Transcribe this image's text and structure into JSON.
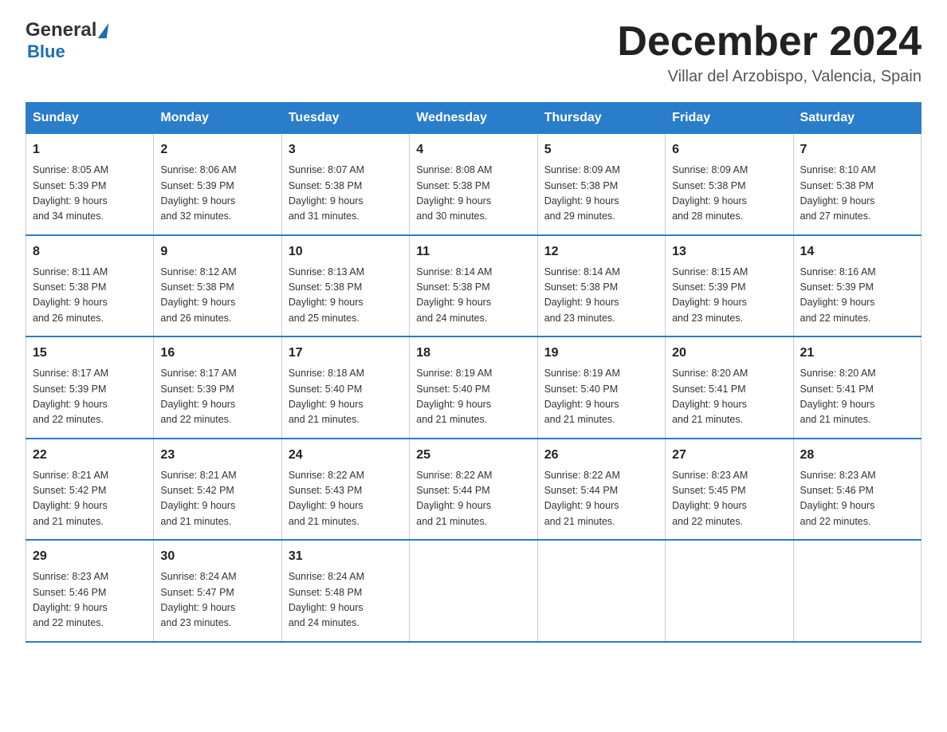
{
  "header": {
    "logo_general": "General",
    "logo_blue": "Blue",
    "title": "December 2024",
    "location": "Villar del Arzobispo, Valencia, Spain"
  },
  "days_of_week": [
    "Sunday",
    "Monday",
    "Tuesday",
    "Wednesday",
    "Thursday",
    "Friday",
    "Saturday"
  ],
  "weeks": [
    [
      {
        "day": "1",
        "sunrise": "8:05 AM",
        "sunset": "5:39 PM",
        "daylight": "9 hours and 34 minutes."
      },
      {
        "day": "2",
        "sunrise": "8:06 AM",
        "sunset": "5:39 PM",
        "daylight": "9 hours and 32 minutes."
      },
      {
        "day": "3",
        "sunrise": "8:07 AM",
        "sunset": "5:38 PM",
        "daylight": "9 hours and 31 minutes."
      },
      {
        "day": "4",
        "sunrise": "8:08 AM",
        "sunset": "5:38 PM",
        "daylight": "9 hours and 30 minutes."
      },
      {
        "day": "5",
        "sunrise": "8:09 AM",
        "sunset": "5:38 PM",
        "daylight": "9 hours and 29 minutes."
      },
      {
        "day": "6",
        "sunrise": "8:09 AM",
        "sunset": "5:38 PM",
        "daylight": "9 hours and 28 minutes."
      },
      {
        "day": "7",
        "sunrise": "8:10 AM",
        "sunset": "5:38 PM",
        "daylight": "9 hours and 27 minutes."
      }
    ],
    [
      {
        "day": "8",
        "sunrise": "8:11 AM",
        "sunset": "5:38 PM",
        "daylight": "9 hours and 26 minutes."
      },
      {
        "day": "9",
        "sunrise": "8:12 AM",
        "sunset": "5:38 PM",
        "daylight": "9 hours and 26 minutes."
      },
      {
        "day": "10",
        "sunrise": "8:13 AM",
        "sunset": "5:38 PM",
        "daylight": "9 hours and 25 minutes."
      },
      {
        "day": "11",
        "sunrise": "8:14 AM",
        "sunset": "5:38 PM",
        "daylight": "9 hours and 24 minutes."
      },
      {
        "day": "12",
        "sunrise": "8:14 AM",
        "sunset": "5:38 PM",
        "daylight": "9 hours and 23 minutes."
      },
      {
        "day": "13",
        "sunrise": "8:15 AM",
        "sunset": "5:39 PM",
        "daylight": "9 hours and 23 minutes."
      },
      {
        "day": "14",
        "sunrise": "8:16 AM",
        "sunset": "5:39 PM",
        "daylight": "9 hours and 22 minutes."
      }
    ],
    [
      {
        "day": "15",
        "sunrise": "8:17 AM",
        "sunset": "5:39 PM",
        "daylight": "9 hours and 22 minutes."
      },
      {
        "day": "16",
        "sunrise": "8:17 AM",
        "sunset": "5:39 PM",
        "daylight": "9 hours and 22 minutes."
      },
      {
        "day": "17",
        "sunrise": "8:18 AM",
        "sunset": "5:40 PM",
        "daylight": "9 hours and 21 minutes."
      },
      {
        "day": "18",
        "sunrise": "8:19 AM",
        "sunset": "5:40 PM",
        "daylight": "9 hours and 21 minutes."
      },
      {
        "day": "19",
        "sunrise": "8:19 AM",
        "sunset": "5:40 PM",
        "daylight": "9 hours and 21 minutes."
      },
      {
        "day": "20",
        "sunrise": "8:20 AM",
        "sunset": "5:41 PM",
        "daylight": "9 hours and 21 minutes."
      },
      {
        "day": "21",
        "sunrise": "8:20 AM",
        "sunset": "5:41 PM",
        "daylight": "9 hours and 21 minutes."
      }
    ],
    [
      {
        "day": "22",
        "sunrise": "8:21 AM",
        "sunset": "5:42 PM",
        "daylight": "9 hours and 21 minutes."
      },
      {
        "day": "23",
        "sunrise": "8:21 AM",
        "sunset": "5:42 PM",
        "daylight": "9 hours and 21 minutes."
      },
      {
        "day": "24",
        "sunrise": "8:22 AM",
        "sunset": "5:43 PM",
        "daylight": "9 hours and 21 minutes."
      },
      {
        "day": "25",
        "sunrise": "8:22 AM",
        "sunset": "5:44 PM",
        "daylight": "9 hours and 21 minutes."
      },
      {
        "day": "26",
        "sunrise": "8:22 AM",
        "sunset": "5:44 PM",
        "daylight": "9 hours and 21 minutes."
      },
      {
        "day": "27",
        "sunrise": "8:23 AM",
        "sunset": "5:45 PM",
        "daylight": "9 hours and 22 minutes."
      },
      {
        "day": "28",
        "sunrise": "8:23 AM",
        "sunset": "5:46 PM",
        "daylight": "9 hours and 22 minutes."
      }
    ],
    [
      {
        "day": "29",
        "sunrise": "8:23 AM",
        "sunset": "5:46 PM",
        "daylight": "9 hours and 22 minutes."
      },
      {
        "day": "30",
        "sunrise": "8:24 AM",
        "sunset": "5:47 PM",
        "daylight": "9 hours and 23 minutes."
      },
      {
        "day": "31",
        "sunrise": "8:24 AM",
        "sunset": "5:48 PM",
        "daylight": "9 hours and 24 minutes."
      },
      null,
      null,
      null,
      null
    ]
  ],
  "labels": {
    "sunrise": "Sunrise:",
    "sunset": "Sunset:",
    "daylight": "Daylight:"
  }
}
